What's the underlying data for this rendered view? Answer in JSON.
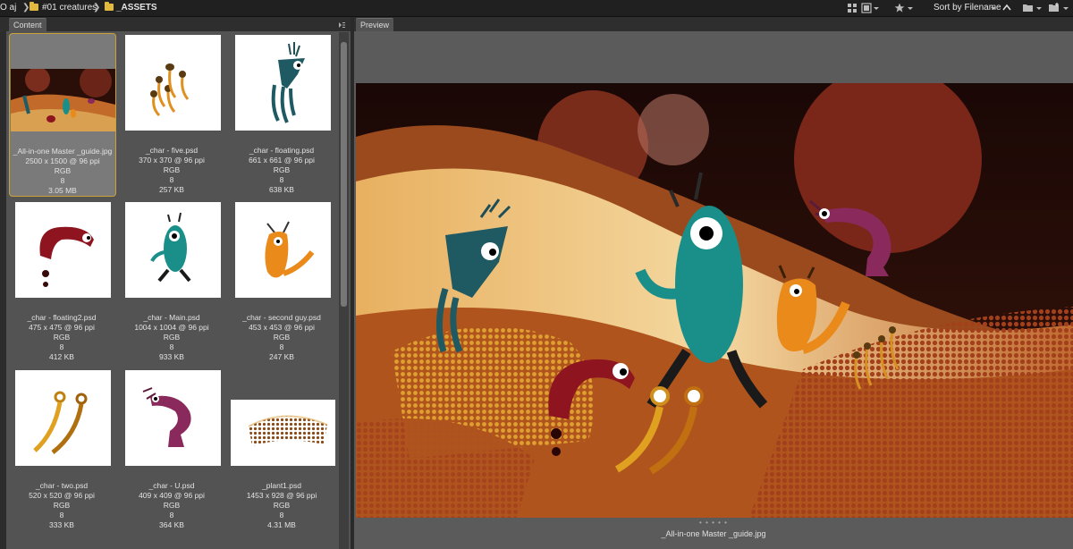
{
  "path_bar": {
    "crumbs": [
      "O aj",
      "#01 creatures",
      "_ASSETS"
    ],
    "sort_label": "Sort by Filename"
  },
  "panels": {
    "content_tab": "Content",
    "preview_tab": "Preview"
  },
  "thumbnails": [
    {
      "name": "_All-in-one Master _guide.jpg",
      "dims": "2500 x 1500 @ 96 ppi",
      "mode": "RGB",
      "bits": "8",
      "size": "3.05 MB",
      "selected": true
    },
    {
      "name": "_char - five.psd",
      "dims": "370 x 370 @ 96 ppi",
      "mode": "RGB",
      "bits": "8",
      "size": "257 KB"
    },
    {
      "name": "_char - floating.psd",
      "dims": "661 x 661 @ 96 ppi",
      "mode": "RGB",
      "bits": "8",
      "size": "638 KB"
    },
    {
      "name": "_char - floating2.psd",
      "dims": "475 x 475 @ 96 ppi",
      "mode": "RGB",
      "bits": "8",
      "size": "412 KB"
    },
    {
      "name": "_char - Main.psd",
      "dims": "1004 x 1004 @ 96 ppi",
      "mode": "RGB",
      "bits": "8",
      "size": "933 KB"
    },
    {
      "name": "_char - second guy.psd",
      "dims": "453 x 453 @ 96 ppi",
      "mode": "RGB",
      "bits": "8",
      "size": "247 KB"
    },
    {
      "name": "_char - two.psd",
      "dims": "520 x 520 @ 96 ppi",
      "mode": "RGB",
      "bits": "8",
      "size": "333 KB"
    },
    {
      "name": "_char - U.psd",
      "dims": "409 x 409 @ 96 ppi",
      "mode": "RGB",
      "bits": "8",
      "size": "364 KB"
    },
    {
      "name": "_plant1.psd",
      "dims": "1453 x 928 @ 96 ppi",
      "mode": "RGB",
      "bits": "8",
      "size": "4.31 MB"
    }
  ],
  "preview": {
    "filename": "_All-in-one Master _guide.jpg",
    "dots": "• • • • •"
  },
  "colors": {
    "selection_border": "#c9a23a",
    "panel_bg": "#535353",
    "preview_bg": "#5b5b5b",
    "teal_creature": "#1a8f8a",
    "orange_creature": "#e98a1a",
    "crimson_creature": "#8e1420",
    "purple_creature": "#8a2a5c"
  },
  "icons": [
    "folder-icon",
    "chevron-right-icon",
    "grid-view-icon",
    "list-view-icon",
    "star-icon",
    "sort-arrow-icon",
    "folder-open-icon",
    "new-folder-icon",
    "panel-menu-icon"
  ]
}
